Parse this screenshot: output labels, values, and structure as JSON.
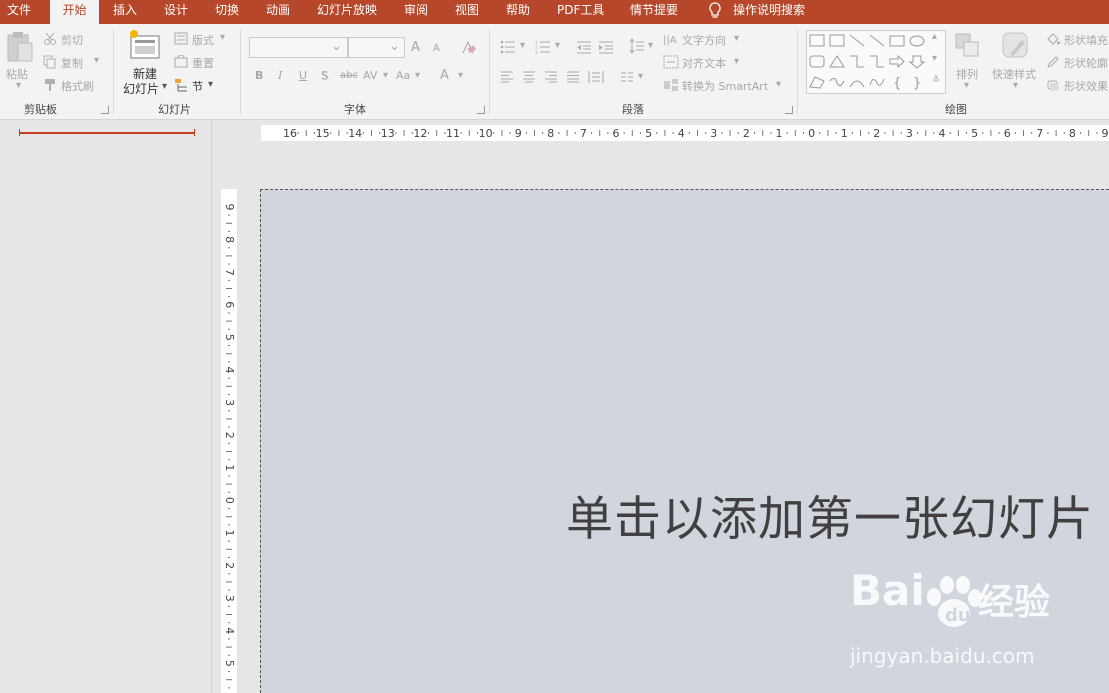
{
  "menu": {
    "tabs": [
      "文件",
      "开始",
      "插入",
      "设计",
      "切换",
      "动画",
      "幻灯片放映",
      "审阅",
      "视图",
      "帮助",
      "PDF工具",
      "情节提要"
    ],
    "active_tab": "开始",
    "search_label": "操作说明搜索",
    "colors": {
      "bar": "#b7472a",
      "active_bg": "#f3f3f3"
    }
  },
  "ribbon": {
    "clipboard": {
      "paste": "粘贴",
      "cut": "剪切",
      "copy": "复制",
      "format_painter": "格式刷",
      "group": "剪贴板"
    },
    "slides": {
      "new_slide_1": "新建",
      "new_slide_2": "幻灯片",
      "layout": "版式",
      "reset": "重置",
      "section": "节",
      "group": "幻灯片"
    },
    "font": {
      "group": "字体",
      "bold": "B",
      "italic": "I",
      "underline": "U",
      "shadow": "S",
      "strike": "abc",
      "spacing": "AV",
      "case": "Aa",
      "grow": "A",
      "shrink": "A",
      "color": "A"
    },
    "paragraph": {
      "text_direction": "文字方向",
      "align_text": "对齐文本",
      "smartart": "转换为 SmartArt",
      "group": "段落"
    },
    "drawing": {
      "arrange": "排列",
      "quick_styles": "快速样式",
      "shape_fill": "形状填充",
      "shape_outline": "形状轮廓",
      "shape_effects": "形状效果",
      "group": "绘图"
    }
  },
  "ruler": {
    "h_ticks": [
      "16",
      "15",
      "14",
      "13",
      "12",
      "11",
      "10",
      "9",
      "8",
      "7",
      "6",
      "5",
      "4",
      "3",
      "2",
      "1",
      "0",
      "1",
      "2",
      "3",
      "4",
      "5",
      "6",
      "7",
      "8",
      "9"
    ],
    "v_ticks": [
      "9",
      "8",
      "7",
      "6",
      "5",
      "4",
      "3",
      "2",
      "1",
      "0",
      "1",
      "2",
      "3",
      "4",
      "5"
    ]
  },
  "slide": {
    "placeholder": "单击以添加第一张幻灯片",
    "bg": "#d0d5de"
  },
  "watermark": {
    "brand": "Bai",
    "brand2": "du",
    "brand_cn": "经验",
    "site": "jingyan.baidu.com"
  }
}
